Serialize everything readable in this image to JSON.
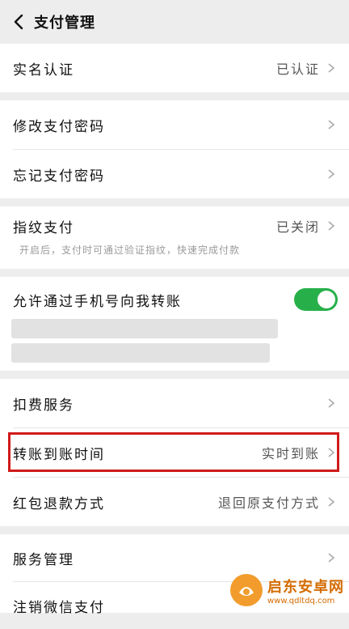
{
  "header": {
    "title": "支付管理",
    "back_icon": "chevron-left-icon"
  },
  "real_name": {
    "label": "实名认证",
    "value": "已认证"
  },
  "password": {
    "change_label": "修改支付密码",
    "forgot_label": "忘记支付密码"
  },
  "fingerprint": {
    "label": "指纹支付",
    "value": "已关闭",
    "hint": "开启后，支付时可通过验证指纹，快速完成付款"
  },
  "phone_transfer": {
    "label": "允许通过手机号向我转账",
    "toggle_state": "on"
  },
  "services": {
    "deduction_label": "扣费服务",
    "transfer_time_label": "转账到账时间",
    "transfer_time_value": "实时到账",
    "refund_label": "红包退款方式",
    "refund_value": "退回原支付方式"
  },
  "management": {
    "service_label": "服务管理",
    "cancel_label": "注销微信支付"
  },
  "watermark": {
    "title": "启东安卓网",
    "url": "www.qdltdq.com"
  },
  "colors": {
    "accent_green": "#27b04a",
    "highlight_red": "#d11a1a"
  }
}
